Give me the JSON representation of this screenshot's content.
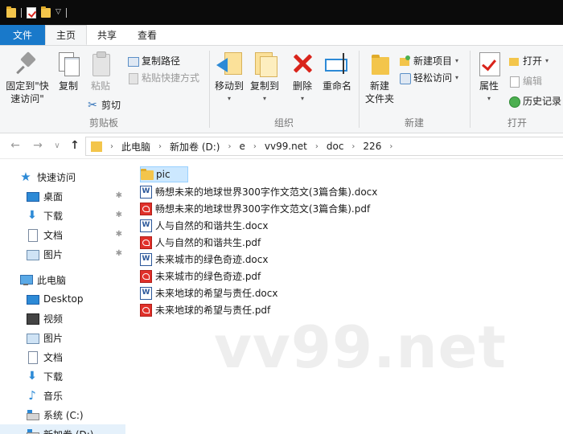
{
  "titlebar": {
    "icons": [
      "folder-icon",
      "properties-check-icon",
      "new-folder-icon",
      "customize-dropdown-icon"
    ]
  },
  "ribbon_tabs": [
    {
      "label": "文件",
      "kind": "file"
    },
    {
      "label": "主页",
      "kind": "active"
    },
    {
      "label": "共享",
      "kind": "normal"
    },
    {
      "label": "查看",
      "kind": "normal"
    }
  ],
  "clipboard": {
    "pin_label_1": "固定到\"快",
    "pin_label_2": "速访问\"",
    "copy_label": "复制",
    "paste_label": "粘贴",
    "copy_path_label": "复制路径",
    "paste_shortcut_label": "粘贴快捷方式",
    "cut_label": "剪切",
    "group_label": "剪贴板"
  },
  "organize": {
    "move_label": "移动到",
    "copy_to_label": "复制到",
    "delete_label": "删除",
    "rename_label": "重命名",
    "group_label": "组织"
  },
  "new": {
    "new_folder_label_1": "新建",
    "new_folder_label_2": "文件夹",
    "new_item_label": "新建项目",
    "easy_access_label": "轻松访问",
    "group_label": "新建"
  },
  "open": {
    "properties_label": "属性",
    "open_label": "打开",
    "edit_label": "编辑",
    "history_label": "历史记录",
    "group_label": "打开"
  },
  "navigation": {
    "back": "←",
    "forward": "→",
    "recent": "∨",
    "up": "↑"
  },
  "breadcrumb": [
    "此电脑",
    "新加卷 (D:)",
    "e",
    "vv99.net",
    "doc",
    "226"
  ],
  "sidebar": {
    "items": [
      {
        "label": "快速访问",
        "icon": "star-icon",
        "pinned": false
      },
      {
        "label": "桌面",
        "icon": "desktop-icon",
        "pinned": true
      },
      {
        "label": "下载",
        "icon": "download-icon",
        "pinned": true
      },
      {
        "label": "文档",
        "icon": "document-icon",
        "pinned": true
      },
      {
        "label": "图片",
        "icon": "pictures-icon",
        "pinned": true
      },
      {
        "label": "此电脑",
        "icon": "computer-icon",
        "pinned": false
      },
      {
        "label": "Desktop",
        "icon": "desktop-icon",
        "pinned": false
      },
      {
        "label": "视频",
        "icon": "video-icon",
        "pinned": false
      },
      {
        "label": "图片",
        "icon": "pictures-icon",
        "pinned": false
      },
      {
        "label": "文档",
        "icon": "document-icon",
        "pinned": false
      },
      {
        "label": "下载",
        "icon": "download-icon",
        "pinned": false
      },
      {
        "label": "音乐",
        "icon": "music-icon",
        "pinned": false
      },
      {
        "label": "系统 (C:)",
        "icon": "drive-icon",
        "pinned": false
      },
      {
        "label": "新加卷 (D:)",
        "icon": "drive-icon",
        "pinned": false
      }
    ]
  },
  "files": [
    {
      "name": "pic",
      "type": "folder"
    },
    {
      "name": "畅想未来的地球世界300字作文范文(3篇合集).docx",
      "type": "docx"
    },
    {
      "name": "畅想未来的地球世界300字作文范文(3篇合集).pdf",
      "type": "pdf"
    },
    {
      "name": "人与自然的和谐共生.docx",
      "type": "docx"
    },
    {
      "name": "人与自然的和谐共生.pdf",
      "type": "pdf"
    },
    {
      "name": "未来城市的绿色奇迹.docx",
      "type": "docx"
    },
    {
      "name": "未来城市的绿色奇迹.pdf",
      "type": "pdf"
    },
    {
      "name": "未来地球的希望与责任.docx",
      "type": "docx"
    },
    {
      "name": "未来地球的希望与责任.pdf",
      "type": "pdf"
    }
  ],
  "watermark": "vv99.net",
  "colors": {
    "accent": "#1979ca",
    "folder": "#f3c54b",
    "pdf": "#e0302a",
    "word": "#2b579a",
    "selection": "#cce8ff"
  }
}
